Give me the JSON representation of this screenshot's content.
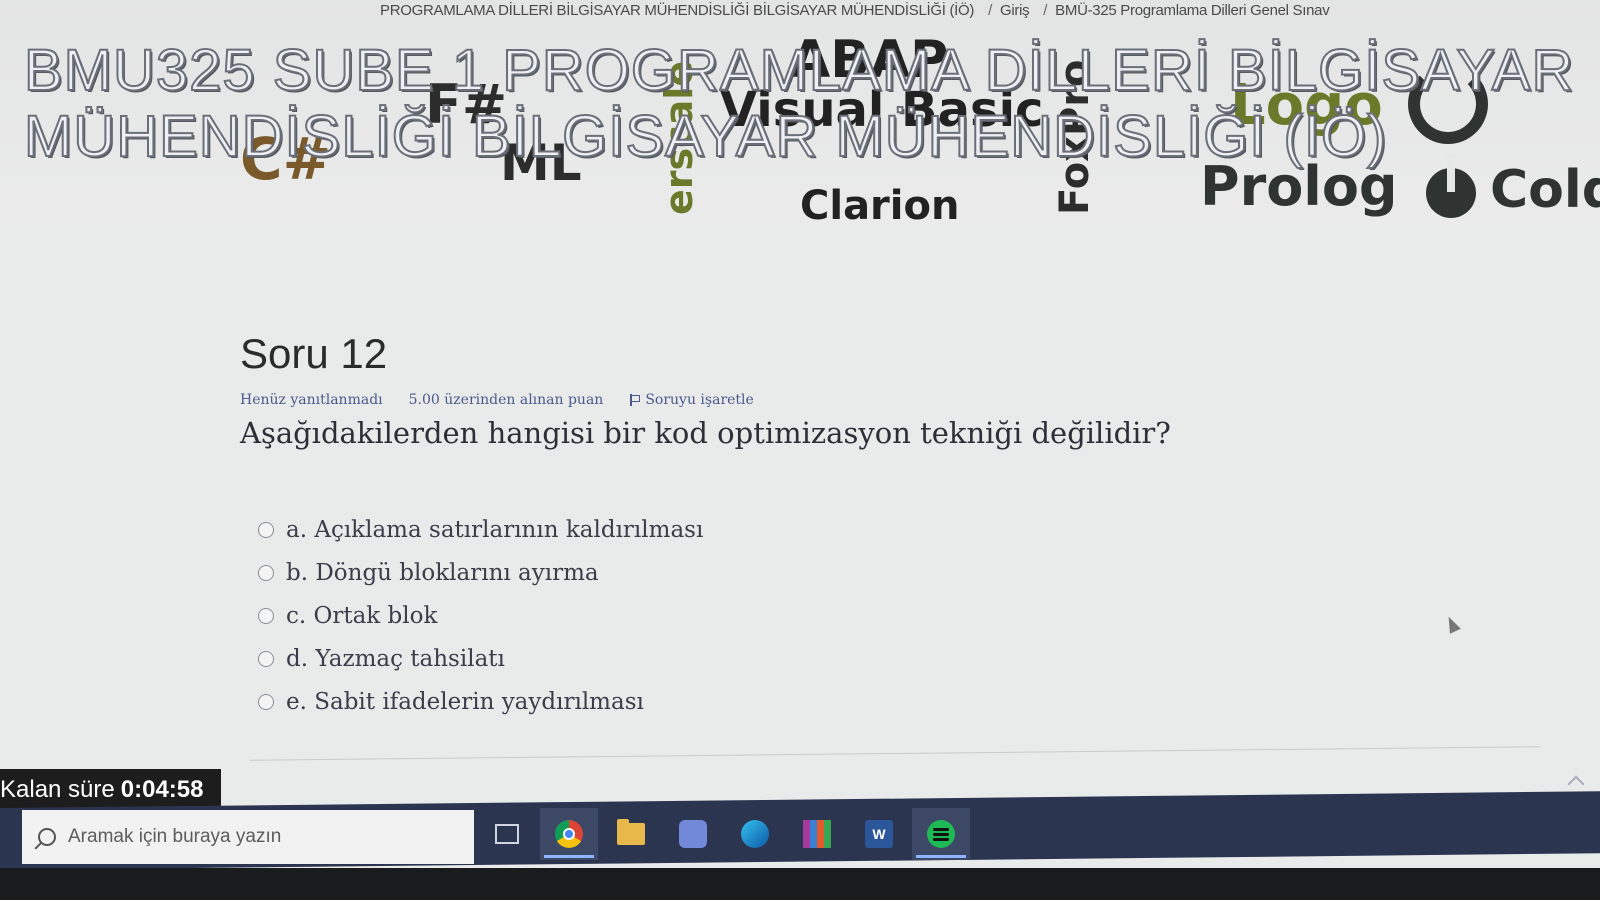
{
  "breadcrumb": {
    "items": [
      "PROGRAMLAMA DİLLERİ BİLGİSAYAR MÜHENDİSLİĞİ BİLGİSAYAR MÜHENDİSLİĞİ (İÖ)",
      "Giriş",
      "BMÜ-325 Programlama Dilleri Genel Sınav"
    ],
    "separator": "/"
  },
  "banner": {
    "course_title": "BMU325 SUBE 1 PROGRAMLAMA DİLLERİ BİLGİSAYAR MÜHENDİSLİĞİ BİLGİSAYAR MÜHENDİSLİĞİ (İÖ)",
    "cloud_words": [
      "ABAP",
      "Visual Basic",
      "F#",
      "Prolog",
      "Cold",
      "Clarion",
      "Logo",
      "FoxPro",
      "erscale",
      "C#",
      "ML"
    ],
    "colors": {
      "dark": "#2f3332",
      "olive": "#6a7a2a",
      "brown": "#7a5a2a"
    }
  },
  "question": {
    "title": "Soru 12",
    "status": "Henüz yanıtlanmadı",
    "grade": "5.00 üzerinden alınan puan",
    "flag_label": "Soruyu işaretle",
    "text": "Aşağıdakilerden hangisi bir kod optimizasyon tekniği değilidir?",
    "answers": [
      {
        "label": "a. Açıklama satırlarının kaldırılması",
        "selected": false
      },
      {
        "label": "b. Döngü bloklarını ayırma",
        "selected": false
      },
      {
        "label": "c. Ortak blok",
        "selected": false
      },
      {
        "label": "d. Yazmaç tahsilatı",
        "selected": false
      },
      {
        "label": "e. Sabit ifadelerin yaydırılması",
        "selected": false
      }
    ]
  },
  "timer": {
    "label": "Kalan süre",
    "value": "0:04:58"
  },
  "taskbar": {
    "search_placeholder": "Aramak için buraya yazın",
    "apps": [
      "task-view-icon",
      "chrome-icon",
      "file-explorer-icon",
      "discord-icon",
      "edge-icon",
      "winrar-icon",
      "word-icon",
      "spotify-icon"
    ],
    "word_glyph": "W"
  }
}
